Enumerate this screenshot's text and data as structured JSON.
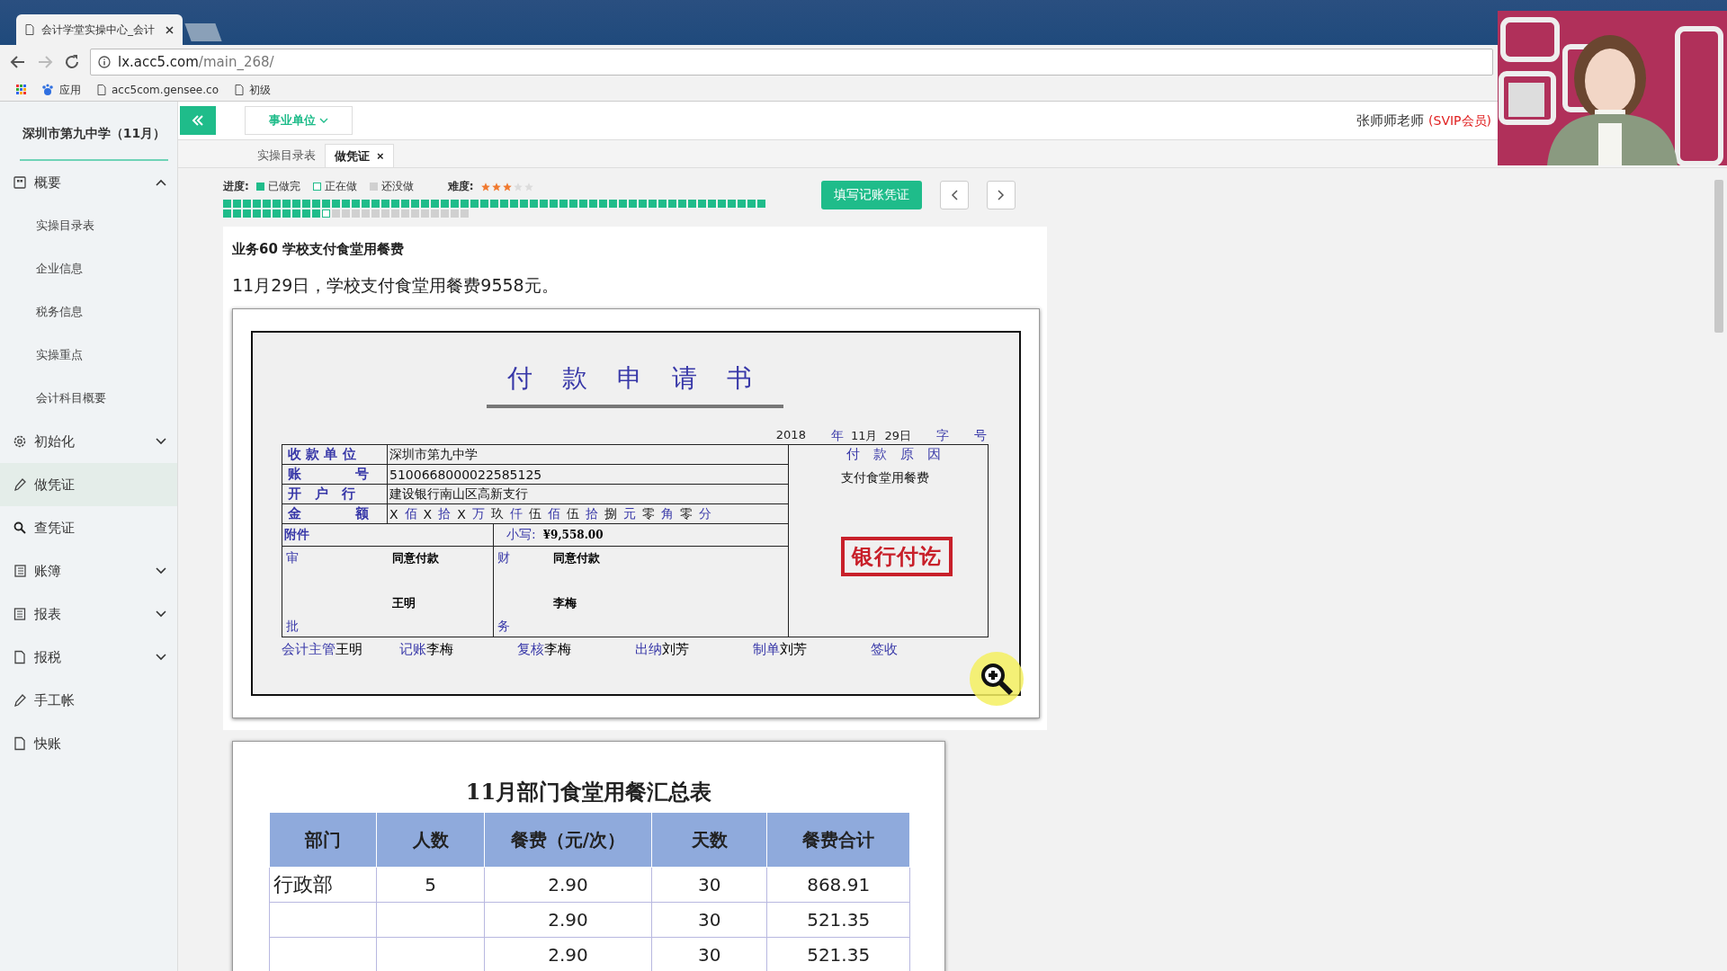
{
  "browser": {
    "tab_title": "会计学堂实操中心_会计",
    "url_host": "lx.acc5.com",
    "url_path": "/main_268/",
    "bookmarks": [
      "应用",
      "acc5com.gensee.co",
      "初级"
    ]
  },
  "header": {
    "unit_dropdown": "事业单位",
    "user": "张师师老师",
    "member_tag": "(SVIP会员)"
  },
  "sidebar": {
    "title": "深圳市第九中学（11月）",
    "items": [
      {
        "label": "概要",
        "selected": false,
        "expanded": true,
        "children": [
          {
            "label": "实操目录表"
          },
          {
            "label": "企业信息"
          },
          {
            "label": "税务信息"
          },
          {
            "label": "实操重点"
          },
          {
            "label": "会计科目概要"
          }
        ]
      },
      {
        "label": "初始化",
        "selected": false,
        "expanded": false
      },
      {
        "label": "做凭证",
        "selected": true
      },
      {
        "label": "查凭证",
        "selected": false
      },
      {
        "label": "账簿",
        "selected": false,
        "expanded": false
      },
      {
        "label": "报表",
        "selected": false,
        "expanded": false
      },
      {
        "label": "报税",
        "selected": false,
        "expanded": false
      },
      {
        "label": "手工帐",
        "selected": false
      },
      {
        "label": "快账",
        "selected": false
      }
    ]
  },
  "page_tabs": [
    {
      "label": "实操目录表",
      "selected": false
    },
    {
      "label": "做凭证",
      "selected": true,
      "close": "×"
    }
  ],
  "progress": {
    "label": "进度:",
    "legend": [
      {
        "kind": "done",
        "text": "已做完"
      },
      {
        "kind": "current",
        "text": "正在做"
      },
      {
        "kind": "todo",
        "text": "还没做"
      }
    ],
    "difficulty_label": "难度:",
    "stars": 3,
    "cells": [
      {
        "kind": "done"
      },
      {
        "kind": "done"
      },
      {
        "kind": "done"
      },
      {
        "kind": "done"
      },
      {
        "kind": "done"
      },
      {
        "kind": "done"
      },
      {
        "kind": "done"
      },
      {
        "kind": "done"
      },
      {
        "kind": "done"
      },
      {
        "kind": "done"
      },
      {
        "kind": "done"
      },
      {
        "kind": "done"
      },
      {
        "kind": "done"
      },
      {
        "kind": "done"
      },
      {
        "kind": "done"
      },
      {
        "kind": "done"
      },
      {
        "kind": "done"
      },
      {
        "kind": "done"
      },
      {
        "kind": "done"
      },
      {
        "kind": "done"
      },
      {
        "kind": "done"
      },
      {
        "kind": "done"
      },
      {
        "kind": "done"
      },
      {
        "kind": "done"
      },
      {
        "kind": "done"
      },
      {
        "kind": "done"
      },
      {
        "kind": "done"
      },
      {
        "kind": "done"
      },
      {
        "kind": "done"
      },
      {
        "kind": "done"
      },
      {
        "kind": "done"
      },
      {
        "kind": "done"
      },
      {
        "kind": "done"
      },
      {
        "kind": "done"
      },
      {
        "kind": "done"
      },
      {
        "kind": "done"
      },
      {
        "kind": "done"
      },
      {
        "kind": "done"
      },
      {
        "kind": "done"
      },
      {
        "kind": "done"
      },
      {
        "kind": "done"
      },
      {
        "kind": "done"
      },
      {
        "kind": "done"
      },
      {
        "kind": "done"
      },
      {
        "kind": "done"
      },
      {
        "kind": "done"
      },
      {
        "kind": "done"
      },
      {
        "kind": "done"
      },
      {
        "kind": "done"
      },
      {
        "kind": "done"
      },
      {
        "kind": "done"
      },
      {
        "kind": "done"
      },
      {
        "kind": "done"
      },
      {
        "kind": "done"
      },
      {
        "kind": "done"
      },
      {
        "kind": "done"
      },
      {
        "kind": "done"
      },
      {
        "kind": "done"
      },
      {
        "kind": "done"
      },
      {
        "kind": "done"
      },
      {
        "kind": "done"
      },
      {
        "kind": "done"
      },
      {
        "kind": "done"
      },
      {
        "kind": "done"
      },
      {
        "kind": "done"
      },
      {
        "kind": "current"
      },
      {
        "kind": "todo"
      },
      {
        "kind": "todo"
      },
      {
        "kind": "todo"
      },
      {
        "kind": "todo"
      },
      {
        "kind": "todo"
      },
      {
        "kind": "todo"
      },
      {
        "kind": "todo"
      },
      {
        "kind": "todo"
      },
      {
        "kind": "todo"
      },
      {
        "kind": "todo"
      },
      {
        "kind": "todo"
      },
      {
        "kind": "todo"
      },
      {
        "kind": "todo"
      },
      {
        "kind": "todo"
      }
    ]
  },
  "fill_button": "填写记账凭证",
  "task": {
    "title": "业务60 学校支付食堂用餐费",
    "description": "11月29日，学校支付食堂用餐费9558元。"
  },
  "voucher": {
    "title": "付 款 申 请 书",
    "date": [
      {
        "kind": "value",
        "text": "2018"
      },
      {
        "kind": "label",
        "text": "年"
      },
      {
        "kind": "value",
        "text": "11月"
      },
      {
        "kind": "value",
        "text": "29日"
      },
      {
        "kind": "label",
        "text": "字"
      },
      {
        "kind": "label",
        "text": "号"
      }
    ],
    "rows": [
      {
        "label": "收 款 单 位",
        "value": "深圳市第九中学"
      },
      {
        "label": "账　　　　号",
        "value": "5100668000022585125"
      },
      {
        "label": "开　户　行",
        "value": "建设银行南山区高新支行"
      }
    ],
    "amount_label": "金　　　　额",
    "amount_words": [
      {
        "digit": "X",
        "unit": "佰"
      },
      {
        "digit": "X",
        "unit": "拾"
      },
      {
        "digit": "X",
        "unit": "万"
      },
      {
        "digit": "玖",
        "unit": "仟"
      },
      {
        "digit": "伍",
        "unit": "佰"
      },
      {
        "digit": "伍",
        "unit": "拾"
      },
      {
        "digit": "捌",
        "unit": "元"
      },
      {
        "digit": "零",
        "unit": "角"
      },
      {
        "digit": "零",
        "unit": "分"
      }
    ],
    "attachment_label": "附件",
    "small_label": "小写:",
    "small_amount": "¥9,558.00",
    "approvals": [
      {
        "top": "审",
        "bottom": "批",
        "opinion": "同意付款",
        "name": "王明"
      },
      {
        "top": "财",
        "bottom": "务",
        "opinion": "同意付款",
        "name": "李梅"
      }
    ],
    "reason_label": "付　款　原　因",
    "reason": "支付食堂用餐费",
    "stamp": "银行付讫",
    "signatures": [
      {
        "label": "会计主管",
        "name": "王明"
      },
      {
        "label": "记账",
        "name": "李梅"
      },
      {
        "label": "复核",
        "name": "李梅"
      },
      {
        "label": "出纳",
        "name": "刘芳"
      },
      {
        "label": "制单",
        "name": "刘芳"
      },
      {
        "label": "签收"
      }
    ]
  },
  "meal_table": {
    "title": "11月部门食堂用餐汇总表",
    "columns": [
      "部门",
      "人数",
      "餐费（元/次）",
      "天数",
      "餐费合计"
    ],
    "rows": [
      {
        "department": "行政部",
        "people": "5",
        "price": "2.90",
        "days": "30",
        "total": "868.91"
      },
      {
        "price": "2.90",
        "days": "30",
        "total": "521.35"
      },
      {
        "price": "2.90",
        "days": "30",
        "total": "521.35"
      }
    ]
  }
}
